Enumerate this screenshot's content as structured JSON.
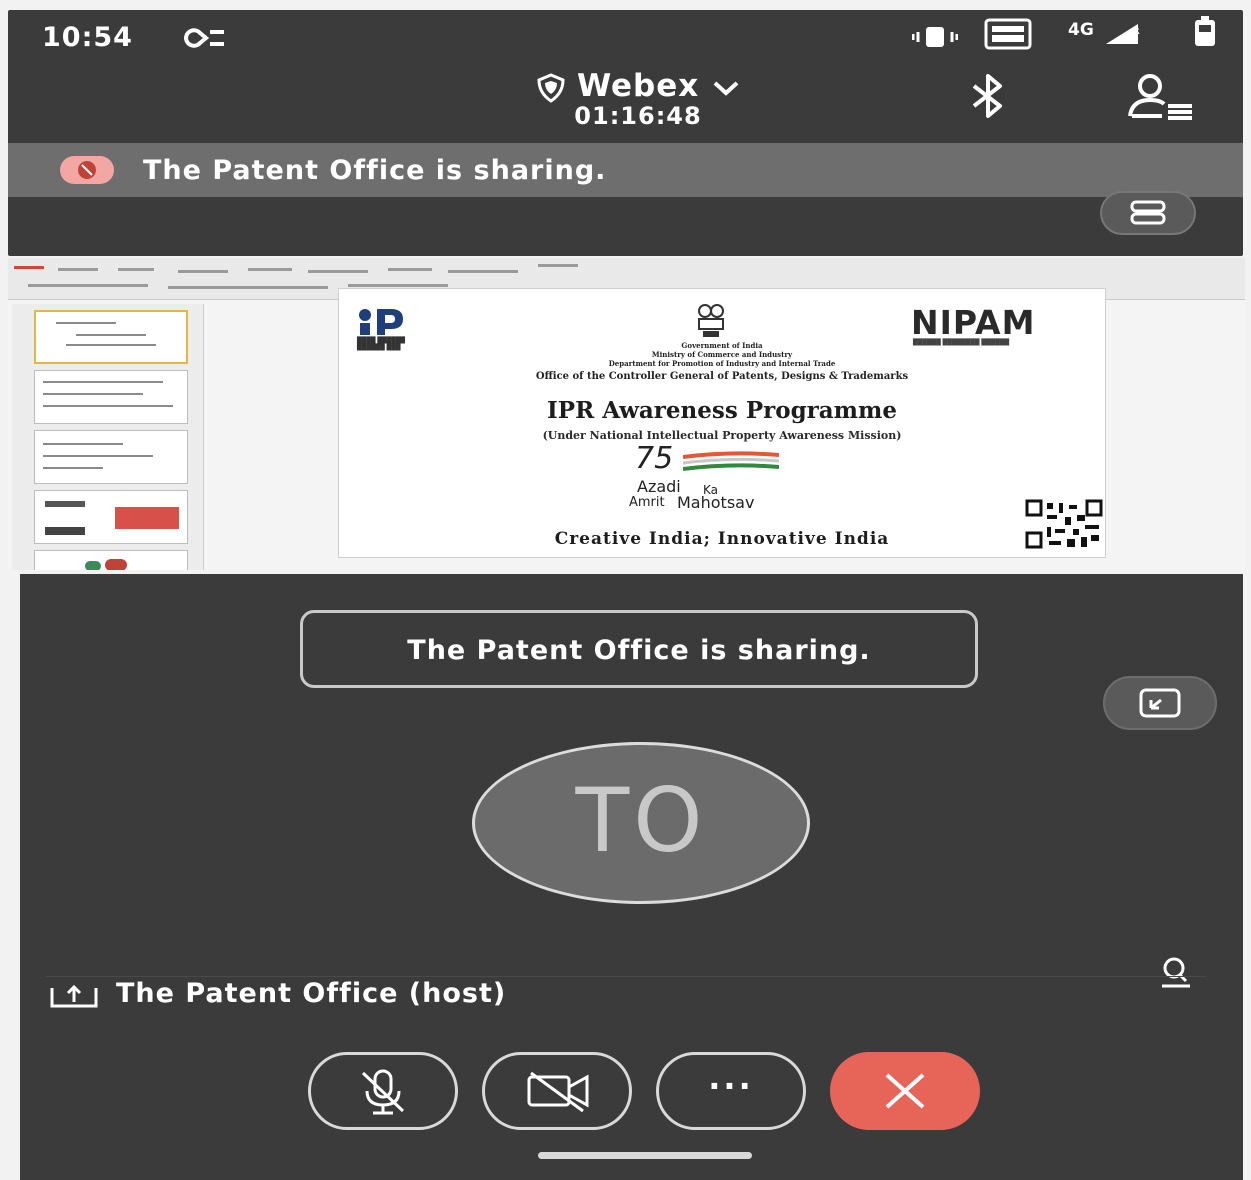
{
  "status_bar": {
    "time": "10:54",
    "network": "4G"
  },
  "header": {
    "app_title": "Webex",
    "call_duration": "01:16:48"
  },
  "banner": {
    "text": "The Patent Office is sharing."
  },
  "slide": {
    "ip_logo_text": "IP",
    "gov_lines": [
      "Government of India",
      "Ministry of Commerce and Industry",
      "Department for Promotion of Industry and Internal Trade",
      "Office of the Controller General of Patents, Designs & Trademarks"
    ],
    "title": "IPR Awareness Programme",
    "subtitle": "(Under National Intellectual Property Awareness Mission)",
    "azadi_number": "75",
    "azadi_word": "Azadi",
    "ka_word": "Ka",
    "amrit_word": "Amrit",
    "mahotsav_word": "Mahotsav",
    "tagline": "Creative India; Innovative India",
    "nipam": "NIPAM"
  },
  "stage": {
    "sharing_text": "The Patent Office is sharing.",
    "avatar_initials": "TO",
    "host_label": "The Patent Office (host)"
  },
  "controls": {
    "more_label": "···"
  }
}
